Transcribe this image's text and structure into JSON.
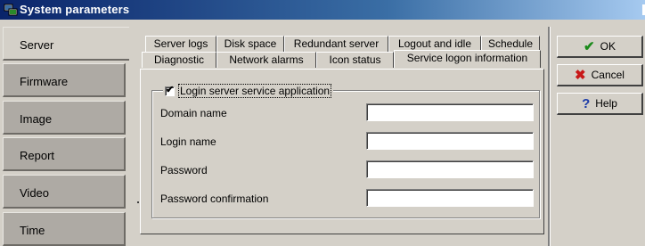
{
  "window": {
    "title": "System parameters"
  },
  "nav": {
    "items": [
      {
        "label": "Server",
        "selected": true
      },
      {
        "label": "Firmware",
        "selected": false
      },
      {
        "label": "Image",
        "selected": false
      },
      {
        "label": "Report",
        "selected": false
      },
      {
        "label": "Video",
        "selected": false
      },
      {
        "label": "Time",
        "selected": false
      }
    ]
  },
  "tabs": {
    "row1": [
      "Server logs",
      "Disk space",
      "Redundant server",
      "Logout and idle",
      "Schedule"
    ],
    "row2": [
      "Diagnostic",
      "Network alarms",
      "Icon status",
      "Service logon information"
    ],
    "active": "Service logon information"
  },
  "group": {
    "checkbox_label": "Login server service application",
    "checked": true,
    "check_mark": "✔"
  },
  "fields": [
    {
      "label": "Domain name",
      "value": ""
    },
    {
      "label": "Login name",
      "value": ""
    },
    {
      "label": "Password",
      "value": ""
    },
    {
      "label": "Password confirmation",
      "value": ""
    }
  ],
  "buttons": {
    "ok": "OK",
    "ok_icon": "✔",
    "cancel": "Cancel",
    "cancel_icon": "✖",
    "help": "Help",
    "help_icon": "?"
  }
}
